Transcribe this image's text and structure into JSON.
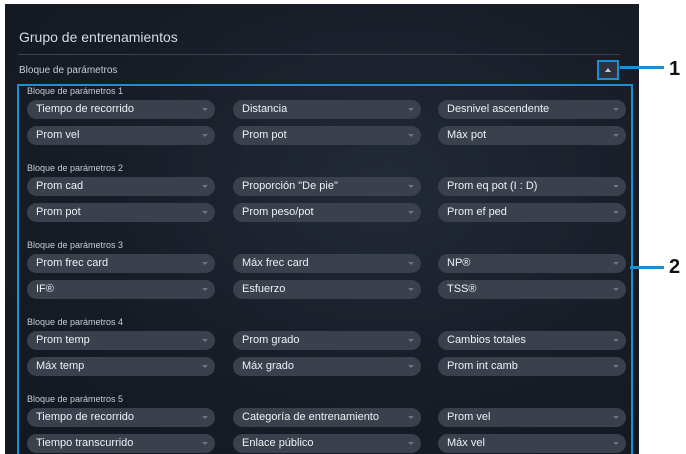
{
  "panel": {
    "title": "Grupo de entrenamientos",
    "section_header": "Bloque de parámetros"
  },
  "blocks": [
    {
      "label": "Bloque de parámetros 1",
      "rows": [
        [
          "Tiempo de recorrido",
          "Distancia",
          "Desnivel ascendente"
        ],
        [
          "Prom vel",
          "Prom pot",
          "Máx pot"
        ]
      ]
    },
    {
      "label": "Bloque de parámetros 2",
      "rows": [
        [
          "Prom cad",
          "Proporción \"De pie\"",
          "Prom eq pot (I : D)"
        ],
        [
          "Prom pot",
          "Prom peso/pot",
          "Prom ef ped"
        ]
      ]
    },
    {
      "label": "Bloque de parámetros 3",
      "rows": [
        [
          "Prom frec card",
          "Máx frec card",
          "NP®"
        ],
        [
          "IF®",
          "Esfuerzo",
          "TSS®"
        ]
      ]
    },
    {
      "label": "Bloque de parámetros 4",
      "rows": [
        [
          "Prom temp",
          "Prom grado",
          "Cambios totales"
        ],
        [
          "Máx temp",
          "Máx grado",
          "Prom int camb"
        ]
      ]
    },
    {
      "label": "Bloque de parámetros 5",
      "rows": [
        [
          "Tiempo de recorrido",
          "Categoría de entrenamiento",
          "Prom vel"
        ],
        [
          "Tiempo transcurrido",
          "Enlace público",
          "Máx vel"
        ]
      ]
    }
  ],
  "callouts": {
    "one": "1",
    "two": "2"
  },
  "colors": {
    "accent": "#1b8fd0",
    "panel_bg": "#171d27",
    "dropdown_bg": "#3a414c"
  },
  "icons": {
    "collapse": "chevron-up-icon",
    "dropdown": "caret-down-icon"
  }
}
